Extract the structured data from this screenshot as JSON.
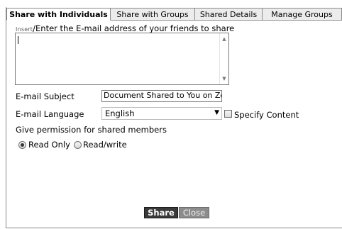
{
  "tabs": [
    {
      "label": "Share with Individuals",
      "active": true
    },
    {
      "label": "Share with Groups",
      "active": false
    },
    {
      "label": "Shared Details",
      "active": false
    },
    {
      "label": "Manage Groups",
      "active": false
    }
  ],
  "emails": {
    "insert_link": "Insert",
    "instruction": "/Enter the E-mail address of your friends to share",
    "value": ""
  },
  "subject": {
    "label": "E-mail Subject",
    "value": "Document Shared to You on Zoh"
  },
  "language": {
    "label": "E-mail Language",
    "selected": "English",
    "specify_content_label": "Specify Content",
    "specify_content_checked": false
  },
  "permission": {
    "label": "Give permission for shared members",
    "options": [
      {
        "label": "Read Only",
        "selected": true
      },
      {
        "label": "Read/write",
        "selected": false
      }
    ]
  },
  "actions": {
    "share_label": "Share",
    "close_label": "Close"
  },
  "colors": {
    "border": "#8a8a8a",
    "tab_inactive_bg": "#ececec",
    "share_bg": "#3a3a3a",
    "close_bg": "#8c8c8c"
  }
}
